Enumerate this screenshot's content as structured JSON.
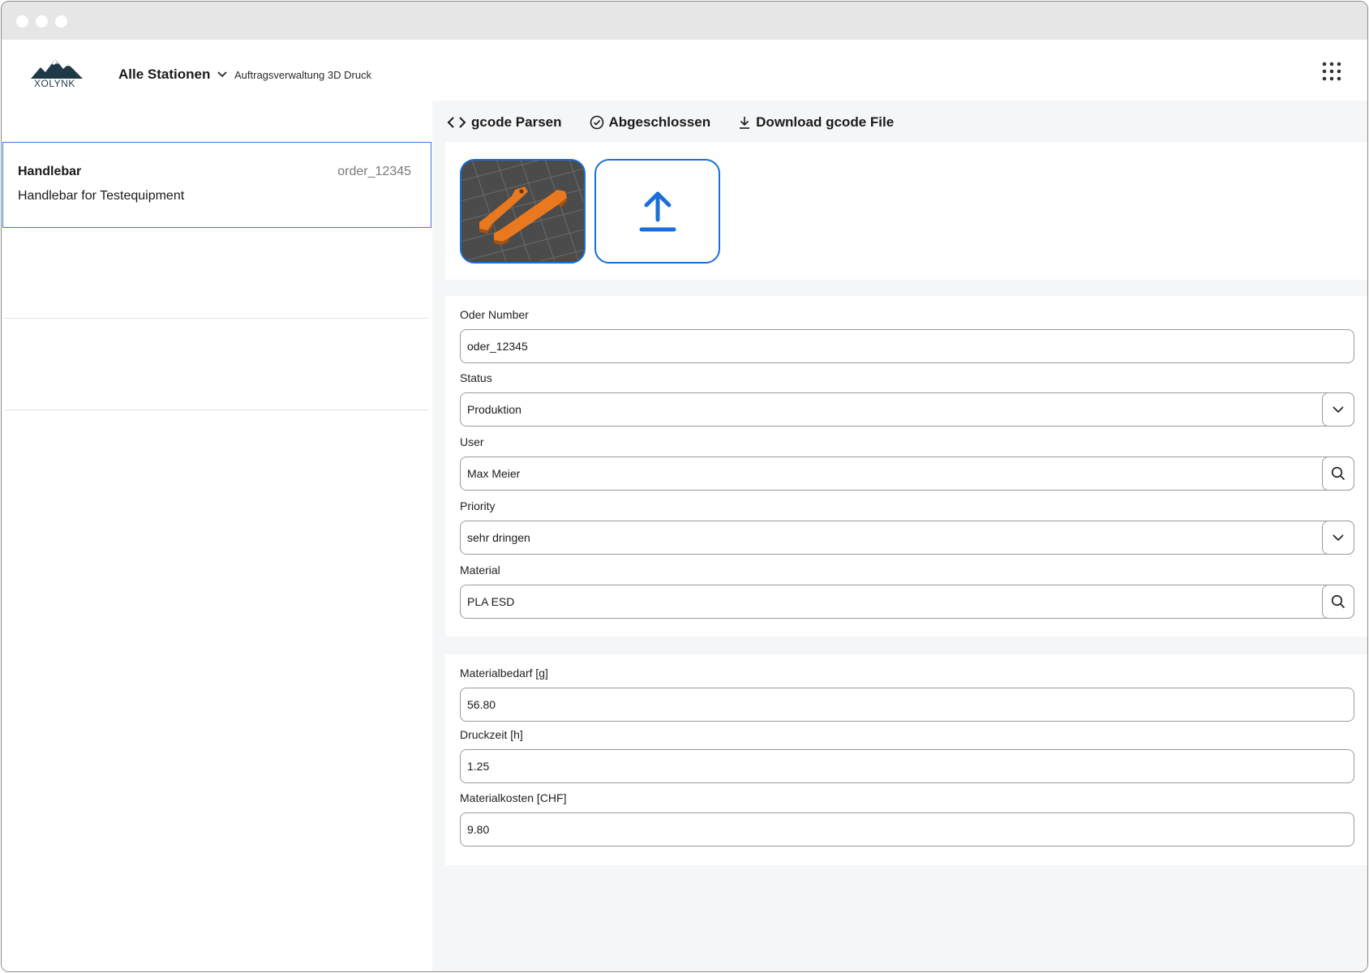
{
  "header": {
    "logo_text": "XOLYNK",
    "station_label": "Alle Stationen",
    "app_subtitle": "Auftragsverwaltung 3D Druck"
  },
  "sidebar": {
    "orders": [
      {
        "title": "Handlebar",
        "order_id": "order_12345",
        "description": "Handlebar for Testequipment",
        "selected": true
      }
    ]
  },
  "toolbar": {
    "parse_label": "gcode Parsen",
    "done_label": "Abgeschlossen",
    "download_label": "Download gcode File"
  },
  "form": {
    "order_number": {
      "label": "Oder Number",
      "value": "oder_12345"
    },
    "status": {
      "label": "Status",
      "value": "Produktion"
    },
    "user": {
      "label": "User",
      "value": "Max Meier"
    },
    "priority": {
      "label": "Priority",
      "value": "sehr dringen"
    },
    "material": {
      "label": "Material",
      "value": "PLA ESD"
    }
  },
  "stats": {
    "material_need": {
      "label": "Materialbedarf [g]",
      "value": "56.80"
    },
    "print_time": {
      "label": "Druckzeit [h]",
      "value": "1.25"
    },
    "material_cost": {
      "label": "Materialkosten [CHF]",
      "value": "9.80"
    }
  },
  "colors": {
    "accent": "#1a6fd8",
    "part_orange": "#e9781e",
    "background": "#f5f6f7"
  },
  "icons": {
    "parse": "code-brackets-icon",
    "done": "check-circle-icon",
    "download": "download-icon",
    "upload": "upload-icon",
    "dropdown": "chevron-down-icon",
    "search": "search-icon",
    "apps": "grid-dots-icon"
  }
}
